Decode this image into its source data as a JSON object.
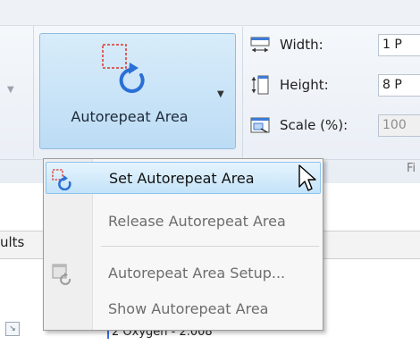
{
  "ribbon": {
    "autorepeat_button": {
      "label": "Autorepeat Area"
    },
    "size": {
      "width_label": "Width:",
      "width_value": "1 P",
      "height_label": "Height:",
      "height_value": "8 P",
      "scale_label": "Scale (%):",
      "scale_value": "100"
    },
    "footer_partial_text": "Fi"
  },
  "document": {
    "partial_label": "ults",
    "snippet_text": "2 Oxygen - 2.008"
  },
  "menu": {
    "items": [
      {
        "label": "Set Autorepeat Area",
        "state": "highlighted",
        "icon": "set-autorepeat-area-icon"
      },
      {
        "label": "Release Autorepeat Area",
        "state": "normal",
        "icon": ""
      },
      {
        "label": "Autorepeat Area Setup...",
        "state": "normal",
        "icon": "autorepeat-area-setup-icon"
      },
      {
        "label": "Show Autorepeat Area",
        "state": "normal",
        "icon": ""
      }
    ]
  },
  "colors": {
    "ribbon_bg": "#e9eef5",
    "button_active": "#bcdcf5",
    "menu_highlight": "#c4e3f9",
    "icon_red_dash": "#e0322a",
    "icon_blue": "#2b6fd6"
  }
}
